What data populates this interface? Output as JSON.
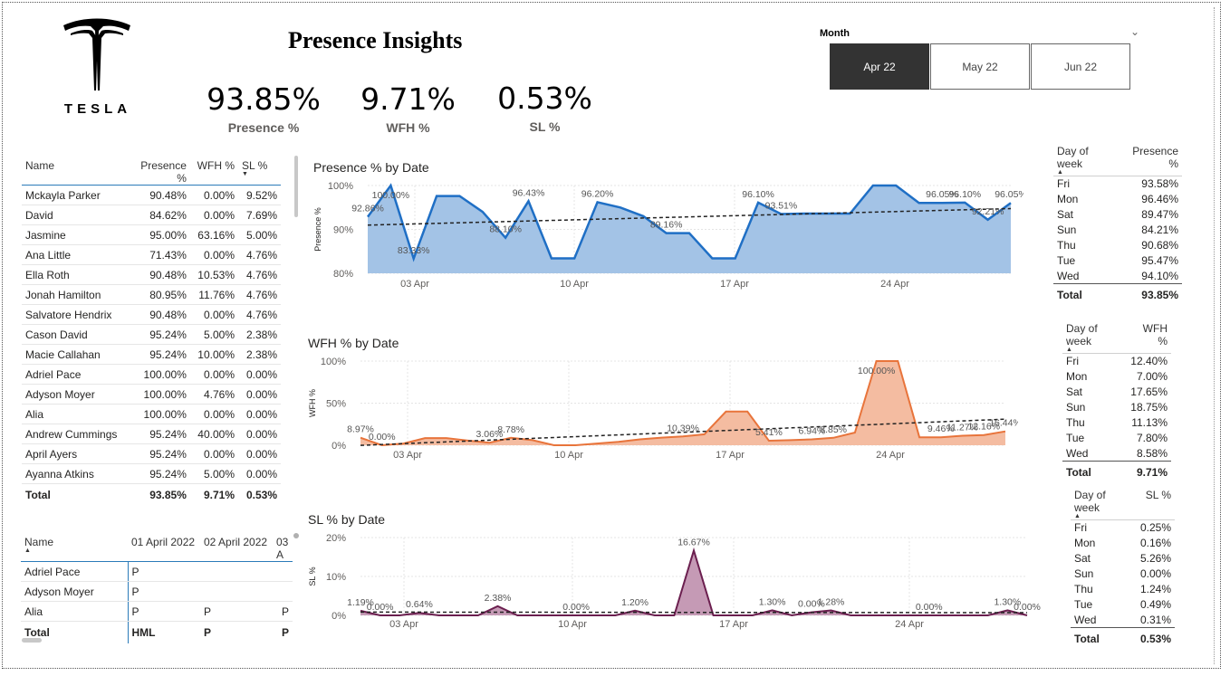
{
  "title": "Presence Insights",
  "logo_text": "TESLA",
  "kpis": [
    {
      "value": "93.85%",
      "label": "Presence %"
    },
    {
      "value": "9.71%",
      "label": "WFH %"
    },
    {
      "value": "0.53%",
      "label": "SL %"
    }
  ],
  "month_slicer": {
    "title": "Month",
    "options": [
      "Apr 22",
      "May 22",
      "Jun 22"
    ],
    "selected": "Apr 22"
  },
  "employee_table": {
    "columns": [
      "Name",
      "Presence %",
      "WFH %",
      "SL %"
    ],
    "rows": [
      [
        "Mckayla Parker",
        "90.48%",
        "0.00%",
        "9.52%"
      ],
      [
        "David",
        "84.62%",
        "0.00%",
        "7.69%"
      ],
      [
        "Jasmine",
        "95.00%",
        "63.16%",
        "5.00%"
      ],
      [
        "Ana Little",
        "71.43%",
        "0.00%",
        "4.76%"
      ],
      [
        "Ella Roth",
        "90.48%",
        "10.53%",
        "4.76%"
      ],
      [
        "Jonah Hamilton",
        "80.95%",
        "11.76%",
        "4.76%"
      ],
      [
        "Salvatore Hendrix",
        "90.48%",
        "0.00%",
        "4.76%"
      ],
      [
        "Cason David",
        "95.24%",
        "5.00%",
        "2.38%"
      ],
      [
        "Macie Callahan",
        "95.24%",
        "10.00%",
        "2.38%"
      ],
      [
        "Adriel Pace",
        "100.00%",
        "0.00%",
        "0.00%"
      ],
      [
        "Adyson Moyer",
        "100.00%",
        "4.76%",
        "0.00%"
      ],
      [
        "Alia",
        "100.00%",
        "0.00%",
        "0.00%"
      ],
      [
        "Andrew Cummings",
        "95.24%",
        "40.00%",
        "0.00%"
      ],
      [
        "April Ayers",
        "95.24%",
        "0.00%",
        "0.00%"
      ],
      [
        "Ayanna Atkins",
        "95.24%",
        "5.00%",
        "0.00%"
      ]
    ],
    "total": [
      "Total",
      "93.85%",
      "9.71%",
      "0.53%"
    ]
  },
  "matrix_table": {
    "columns": [
      "Name",
      "01 April 2022",
      "02 April 2022",
      "03 A"
    ],
    "rows": [
      [
        "Adriel Pace",
        "P",
        "",
        ""
      ],
      [
        "Adyson Moyer",
        "P",
        "",
        ""
      ],
      [
        "Alia",
        "P",
        "P",
        "P"
      ]
    ],
    "total": [
      "Total",
      "HML",
      "P",
      "P"
    ]
  },
  "dow_tables": [
    {
      "columns": [
        "Day of week",
        "Presence %"
      ],
      "rows": [
        [
          "Fri",
          "93.58%"
        ],
        [
          "Mon",
          "96.46%"
        ],
        [
          "Sat",
          "89.47%"
        ],
        [
          "Sun",
          "84.21%"
        ],
        [
          "Thu",
          "90.68%"
        ],
        [
          "Tue",
          "95.47%"
        ],
        [
          "Wed",
          "94.10%"
        ]
      ],
      "total": [
        "Total",
        "93.85%"
      ]
    },
    {
      "columns": [
        "Day of week",
        "WFH %"
      ],
      "rows": [
        [
          "Fri",
          "12.40%"
        ],
        [
          "Mon",
          "7.00%"
        ],
        [
          "Sat",
          "17.65%"
        ],
        [
          "Sun",
          "18.75%"
        ],
        [
          "Thu",
          "11.13%"
        ],
        [
          "Tue",
          "7.80%"
        ],
        [
          "Wed",
          "8.58%"
        ]
      ],
      "total": [
        "Total",
        "9.71%"
      ]
    },
    {
      "columns": [
        "Day of week",
        "SL %"
      ],
      "rows": [
        [
          "Fri",
          "0.25%"
        ],
        [
          "Mon",
          "0.16%"
        ],
        [
          "Sat",
          "5.26%"
        ],
        [
          "Sun",
          "0.00%"
        ],
        [
          "Thu",
          "1.24%"
        ],
        [
          "Tue",
          "0.49%"
        ],
        [
          "Wed",
          "0.31%"
        ]
      ],
      "total": [
        "Total",
        "0.53%"
      ]
    }
  ],
  "chart_data": [
    {
      "type": "area",
      "title": "Presence % by Date",
      "ylabel": "Presence %",
      "ylim": [
        80,
        100
      ],
      "yticks": [
        "100%",
        "90%",
        "80%"
      ],
      "xticks": [
        "03 Apr",
        "10 Apr",
        "17 Apr",
        "24 Apr"
      ],
      "color": "#1f6fc5",
      "fill": "#a3c3e6",
      "values": [
        92.86,
        100,
        83.33,
        97.6,
        97.6,
        94,
        88.1,
        96.43,
        83.4,
        83.4,
        96.2,
        95,
        93,
        89.16,
        89.16,
        83.4,
        83.4,
        96.1,
        93.51,
        93.6,
        93.6,
        93.6,
        100,
        100,
        96.05,
        96.05,
        96.1,
        92.21,
        96.05
      ],
      "labels": [
        {
          "i": 0,
          "text": "92.86%"
        },
        {
          "i": 1,
          "text": "100.00%"
        },
        {
          "i": 2,
          "text": "83.33%"
        },
        {
          "i": 6,
          "text": "88.10%"
        },
        {
          "i": 7,
          "text": "96.43%"
        },
        {
          "i": 10,
          "text": "96.20%"
        },
        {
          "i": 13,
          "text": "89.16%"
        },
        {
          "i": 17,
          "text": "96.10%"
        },
        {
          "i": 18,
          "text": "93.51%"
        },
        {
          "i": 25,
          "text": "96.05%"
        },
        {
          "i": 26,
          "text": "96.10%"
        },
        {
          "i": 27,
          "text": "92.21%"
        },
        {
          "i": 28,
          "text": "96.05%"
        }
      ]
    },
    {
      "type": "area",
      "title": "WFH % by Date",
      "ylabel": "WFH %",
      "ylim": [
        0,
        100
      ],
      "yticks": [
        "100%",
        "50%",
        "0%"
      ],
      "xticks": [
        "03 Apr",
        "10 Apr",
        "17 Apr",
        "24 Apr"
      ],
      "color": "#e8743b",
      "fill": "#f4bca1",
      "values": [
        8.97,
        0,
        2,
        8.5,
        8.5,
        5.5,
        3.06,
        8.78,
        6,
        0,
        0,
        2,
        4,
        7,
        9,
        10.39,
        13,
        40,
        40,
        5.41,
        6,
        6.94,
        8.85,
        15,
        100,
        100,
        9.46,
        9.46,
        11.27,
        12.16,
        16.44
      ],
      "labels": [
        {
          "i": 0,
          "text": "8.97%"
        },
        {
          "i": 1,
          "text": "0.00%"
        },
        {
          "i": 6,
          "text": "3.06%"
        },
        {
          "i": 7,
          "text": "8.78%"
        },
        {
          "i": 15,
          "text": "10.39%"
        },
        {
          "i": 19,
          "text": "5.41%"
        },
        {
          "i": 21,
          "text": "6.94%"
        },
        {
          "i": 22,
          "text": "8.85%"
        },
        {
          "i": 24,
          "text": "100.00%"
        },
        {
          "i": 27,
          "text": "9.46%"
        },
        {
          "i": 28,
          "text": "11.27%"
        },
        {
          "i": 29,
          "text": "12.16%"
        },
        {
          "i": 30,
          "text": "16.44%"
        }
      ]
    },
    {
      "type": "area",
      "title": "SL % by Date",
      "ylabel": "SL %",
      "ylim": [
        0,
        20
      ],
      "yticks": [
        "20%",
        "10%",
        "0%"
      ],
      "xticks": [
        "03 Apr",
        "10 Apr",
        "17 Apr",
        "24 Apr"
      ],
      "color": "#6b1f4f",
      "fill": "#c59ab5",
      "values": [
        1.19,
        0,
        0,
        0.64,
        0,
        0,
        0,
        2.38,
        0,
        0,
        0,
        0,
        0,
        0,
        1.2,
        0,
        0,
        16.67,
        0,
        0,
        0,
        1.3,
        0,
        0.8,
        1.28,
        0,
        0,
        0,
        0,
        0,
        0,
        0,
        0,
        1.3,
        0
      ],
      "labels": [
        {
          "i": 0,
          "text": "1.19%"
        },
        {
          "i": 1,
          "text": "0.00%"
        },
        {
          "i": 3,
          "text": "0.64%"
        },
        {
          "i": 7,
          "text": "2.38%"
        },
        {
          "i": 11,
          "text": "0.00%"
        },
        {
          "i": 14,
          "text": "1.20%"
        },
        {
          "i": 17,
          "text": "16.67%"
        },
        {
          "i": 21,
          "text": "1.30%"
        },
        {
          "i": 23,
          "text": "0.00%"
        },
        {
          "i": 24,
          "text": "1.28%"
        },
        {
          "i": 29,
          "text": "0.00%"
        },
        {
          "i": 33,
          "text": "1.30%"
        },
        {
          "i": 34,
          "text": "0.00%"
        }
      ]
    }
  ]
}
